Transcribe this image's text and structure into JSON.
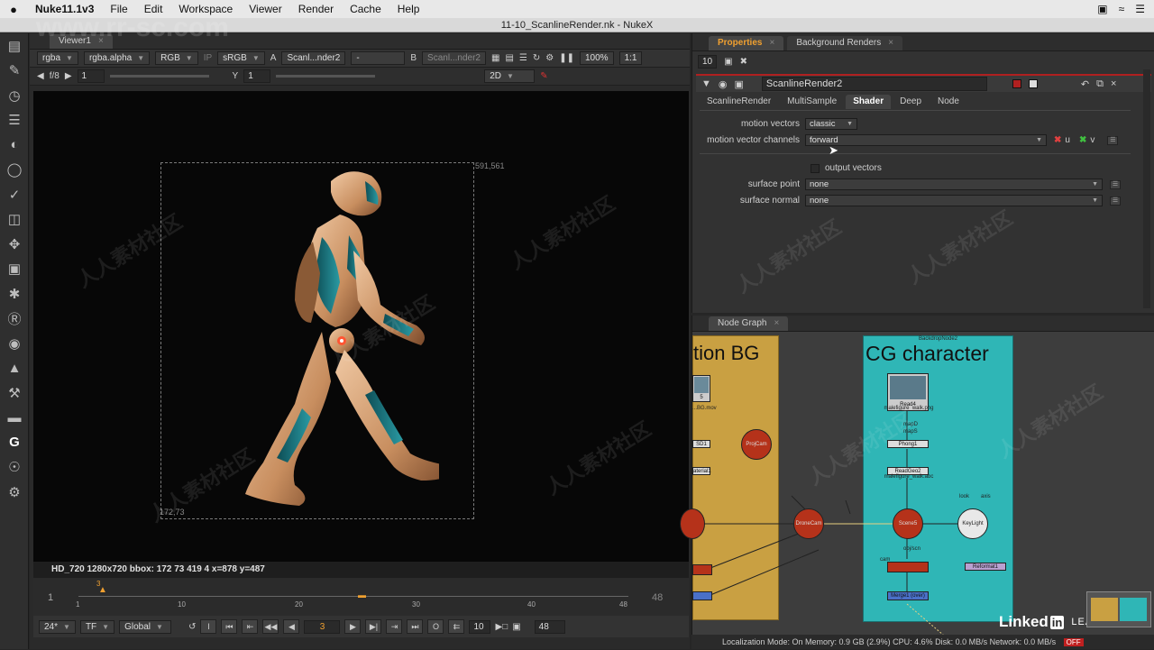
{
  "menubar": {
    "apple": "",
    "items": [
      "Nuke11.1v3",
      "File",
      "Edit",
      "Workspace",
      "Viewer",
      "Render",
      "Cache",
      "Help"
    ]
  },
  "window": {
    "title": "11-10_ScanlineRender.nk - NukeX"
  },
  "watermark": {
    "site": "www.rr-sc.com",
    "cn": "人人素材社区"
  },
  "viewer": {
    "tab": "Viewer1",
    "channels": "rgba",
    "alpha": "rgba.alpha",
    "display": "RGB",
    "ip": "IP",
    "lut": "sRGB",
    "a_label": "A",
    "a_input": "Scanl...nder2",
    "dash": "-",
    "b_label": "B",
    "b_input": "Scanl...nder2",
    "zoom": "100%",
    "ratio": "1:1",
    "fstop": "f/8",
    "gain": "1",
    "y_label": "Y",
    "gamma": "1",
    "mode": "2D",
    "bbox_tr": "591,561",
    "bbox_bl": "172,73",
    "info": "HD_720 1280x720  bbox: 172 73 419 4  x=878 y=487",
    "timeline": {
      "start": "1",
      "end": "48",
      "ticks": [
        "1",
        "10",
        "20",
        "30",
        "40",
        "48"
      ],
      "current": "3",
      "right": "48"
    },
    "transport": {
      "fps": "24*",
      "tf": "TF",
      "global": "Global",
      "frame": "3",
      "inc": "10",
      "end": "48"
    }
  },
  "properties": {
    "tabs": [
      "Properties",
      "Background Renders"
    ],
    "max_panels": "10",
    "node_name": "ScanlineRender2",
    "subtabs": [
      "ScanlineRender",
      "MultiSample",
      "Shader",
      "Deep",
      "Node"
    ],
    "active_subtab": "Shader",
    "motion_vectors": {
      "label": "motion vectors",
      "value": "classic"
    },
    "mv_channels": {
      "label": "motion vector channels",
      "value": "forward",
      "u": "u",
      "v": "v"
    },
    "output_vectors": {
      "label": "output vectors",
      "checked": false
    },
    "surface_point": {
      "label": "surface point",
      "value": "none"
    },
    "surface_normal": {
      "label": "surface normal",
      "value": "none"
    }
  },
  "node_graph": {
    "tab": "Node Graph",
    "backdrop_left": "tion BG",
    "backdrop_right": "CG character",
    "backdrop_right_id": "BackdropNode2",
    "nodes": {
      "read4": "Read4",
      "read4_file": "malefigure_walk.png",
      "left_read": "5",
      "left_read_file": "...BG.mov",
      "proj_cam": "ProjCam",
      "drone_cam": "DroneCam",
      "scene": "Scene5",
      "keylight": "KeyLight",
      "phong": "Phong1",
      "readgeo": "ReadGeo2",
      "readgeo_file": "malefigure_walk.abc",
      "reformat": "Reformat1",
      "merge": "Merge1 (over)",
      "sd1": "SD1",
      "material": "aterial1",
      "lbl_mapd": "mapD",
      "lbl_mapS": "mapS",
      "lbl_obj": "obj/scn",
      "lbl_cam": "cam",
      "lbl_look": "look",
      "lbl_axis": "axis"
    }
  },
  "status": {
    "text": "Localization Mode: On  Memory: 0.9 GB (2.9%)  CPU: 4.6%  Disk: 0.0 MB/s  Network: 0.0 MB/s",
    "off": "OFF"
  },
  "linkedin": {
    "brand": "Linked",
    "in": "in",
    "learning": "LEARNING"
  },
  "colors": {
    "accent": "#f0a030",
    "backdrop_gold": "#c9a042",
    "backdrop_teal": "#2fb6b6",
    "node_red": "#b5321a",
    "suit_teal": "#1e7f86",
    "suit_copper": "#d9a37a"
  }
}
